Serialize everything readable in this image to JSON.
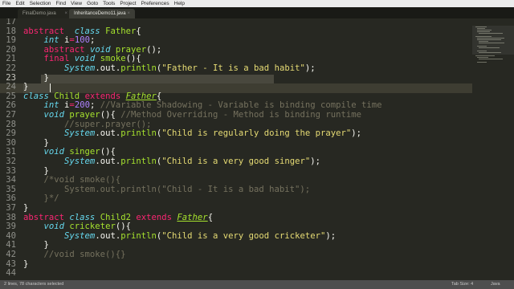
{
  "menu": [
    "File",
    "Edit",
    "Selection",
    "Find",
    "View",
    "Goto",
    "Tools",
    "Project",
    "Preferences",
    "Help"
  ],
  "tabs": [
    {
      "label": "FinalDemo.java",
      "close": "×"
    },
    {
      "label": "InheritanceDemo11.java",
      "close": "×"
    }
  ],
  "lines": [
    {
      "n": "17",
      "t": []
    },
    {
      "n": "18",
      "t": [
        [
          "kw",
          "abstract"
        ],
        [
          "",
          "  "
        ],
        [
          "st",
          "class"
        ],
        [
          "",
          " "
        ],
        [
          "cl",
          "Father"
        ],
        [
          "",
          "{"
        ]
      ]
    },
    {
      "n": "19",
      "t": [
        [
          "",
          "    "
        ],
        [
          "st",
          "int"
        ],
        [
          "",
          " i"
        ],
        [
          "kw",
          "="
        ],
        [
          "nu",
          "100"
        ],
        [
          "",
          ";"
        ]
      ]
    },
    {
      "n": "20",
      "t": [
        [
          "",
          "    "
        ],
        [
          "kw",
          "abstract"
        ],
        [
          "",
          " "
        ],
        [
          "st",
          "void"
        ],
        [
          "",
          " "
        ],
        [
          "fn",
          "prayer"
        ],
        [
          "",
          "();"
        ]
      ]
    },
    {
      "n": "21",
      "t": [
        [
          "",
          "    "
        ],
        [
          "kw",
          "final"
        ],
        [
          "",
          " "
        ],
        [
          "st",
          "void"
        ],
        [
          "",
          " "
        ],
        [
          "fn",
          "smoke"
        ],
        [
          "",
          "(){"
        ]
      ]
    },
    {
      "n": "22",
      "t": [
        [
          "",
          "        "
        ],
        [
          "sc",
          "System"
        ],
        [
          "",
          ".out."
        ],
        [
          "fn",
          "println"
        ],
        [
          "",
          "("
        ],
        [
          "str",
          "\"Father - It is a bad habit\""
        ],
        [
          "",
          ");"
        ]
      ]
    },
    {
      "n": "23",
      "t": [
        [
          "",
          "    }"
        ]
      ]
    },
    {
      "n": "24",
      "t": [
        [
          "",
          "}"
        ]
      ]
    },
    {
      "n": "25",
      "t": [
        [
          "st",
          "class"
        ],
        [
          "",
          " "
        ],
        [
          "cl",
          "Child"
        ],
        [
          "",
          " "
        ],
        [
          "kw",
          "extends"
        ],
        [
          "",
          " "
        ],
        [
          "cli",
          "Father"
        ],
        [
          "",
          "{"
        ]
      ]
    },
    {
      "n": "26",
      "t": [
        [
          "",
          "    "
        ],
        [
          "st",
          "int"
        ],
        [
          "",
          " i"
        ],
        [
          "kw",
          "="
        ],
        [
          "nu",
          "200"
        ],
        [
          "",
          "; "
        ],
        [
          "cm",
          "//Variable Shadowing - Variable is binding compile time"
        ]
      ]
    },
    {
      "n": "27",
      "t": [
        [
          "",
          "    "
        ],
        [
          "st",
          "void"
        ],
        [
          "",
          " "
        ],
        [
          "fn",
          "prayer"
        ],
        [
          "",
          "(){ "
        ],
        [
          "cm",
          "//Method Overriding - Method is binding runtime"
        ]
      ]
    },
    {
      "n": "28",
      "t": [
        [
          "",
          "        "
        ],
        [
          "cm",
          "//super.prayer();"
        ]
      ]
    },
    {
      "n": "29",
      "t": [
        [
          "",
          "        "
        ],
        [
          "sc",
          "System"
        ],
        [
          "",
          ".out."
        ],
        [
          "fn",
          "println"
        ],
        [
          "",
          "("
        ],
        [
          "str",
          "\"Child is regularly doing the prayer\""
        ],
        [
          "",
          ");"
        ]
      ]
    },
    {
      "n": "30",
      "t": [
        [
          "",
          "    }"
        ]
      ]
    },
    {
      "n": "31",
      "t": [
        [
          "",
          "    "
        ],
        [
          "st",
          "void"
        ],
        [
          "",
          " "
        ],
        [
          "fn",
          "singer"
        ],
        [
          "",
          "(){"
        ]
      ]
    },
    {
      "n": "32",
      "t": [
        [
          "",
          "        "
        ],
        [
          "sc",
          "System"
        ],
        [
          "",
          ".out."
        ],
        [
          "fn",
          "println"
        ],
        [
          "",
          "("
        ],
        [
          "str",
          "\"Child is a very good singer\""
        ],
        [
          "",
          ");"
        ]
      ]
    },
    {
      "n": "33",
      "t": [
        [
          "",
          "    }"
        ]
      ]
    },
    {
      "n": "34",
      "t": [
        [
          "",
          "    "
        ],
        [
          "cm",
          "/*void smoke(){"
        ]
      ]
    },
    {
      "n": "35",
      "t": [
        [
          "cm",
          "        System.out.println(\"Child - It is a bad habit\");"
        ]
      ]
    },
    {
      "n": "36",
      "t": [
        [
          "cm",
          "    }*/"
        ]
      ]
    },
    {
      "n": "37",
      "t": [
        [
          "",
          "}"
        ]
      ]
    },
    {
      "n": "38",
      "t": [
        [
          "kw",
          "abstract"
        ],
        [
          "",
          " "
        ],
        [
          "st",
          "class"
        ],
        [
          "",
          " "
        ],
        [
          "cl",
          "Child2"
        ],
        [
          "",
          " "
        ],
        [
          "kw",
          "extends"
        ],
        [
          "",
          " "
        ],
        [
          "cli",
          "Father"
        ],
        [
          "",
          "{"
        ]
      ]
    },
    {
      "n": "39",
      "t": [
        [
          "",
          "    "
        ],
        [
          "st",
          "void"
        ],
        [
          "",
          " "
        ],
        [
          "fn",
          "cricketer"
        ],
        [
          "",
          "(){"
        ]
      ]
    },
    {
      "n": "40",
      "t": [
        [
          "",
          "        "
        ],
        [
          "sc",
          "System"
        ],
        [
          "",
          ".out."
        ],
        [
          "fn",
          "println"
        ],
        [
          "",
          "("
        ],
        [
          "str",
          "\"Child is a very good cricketer\""
        ],
        [
          "",
          ");"
        ]
      ]
    },
    {
      "n": "41",
      "t": [
        [
          "",
          "    }"
        ]
      ]
    },
    {
      "n": "42",
      "t": [
        [
          "",
          "    "
        ],
        [
          "cm",
          "//void smoke(){}"
        ]
      ]
    },
    {
      "n": "43",
      "t": [
        [
          "",
          "}"
        ]
      ]
    },
    {
      "n": "44",
      "t": []
    }
  ],
  "status": {
    "selection": "2 lines, 78 characters selected",
    "tab_size": "Tab Size: 4",
    "syntax": "Java"
  }
}
